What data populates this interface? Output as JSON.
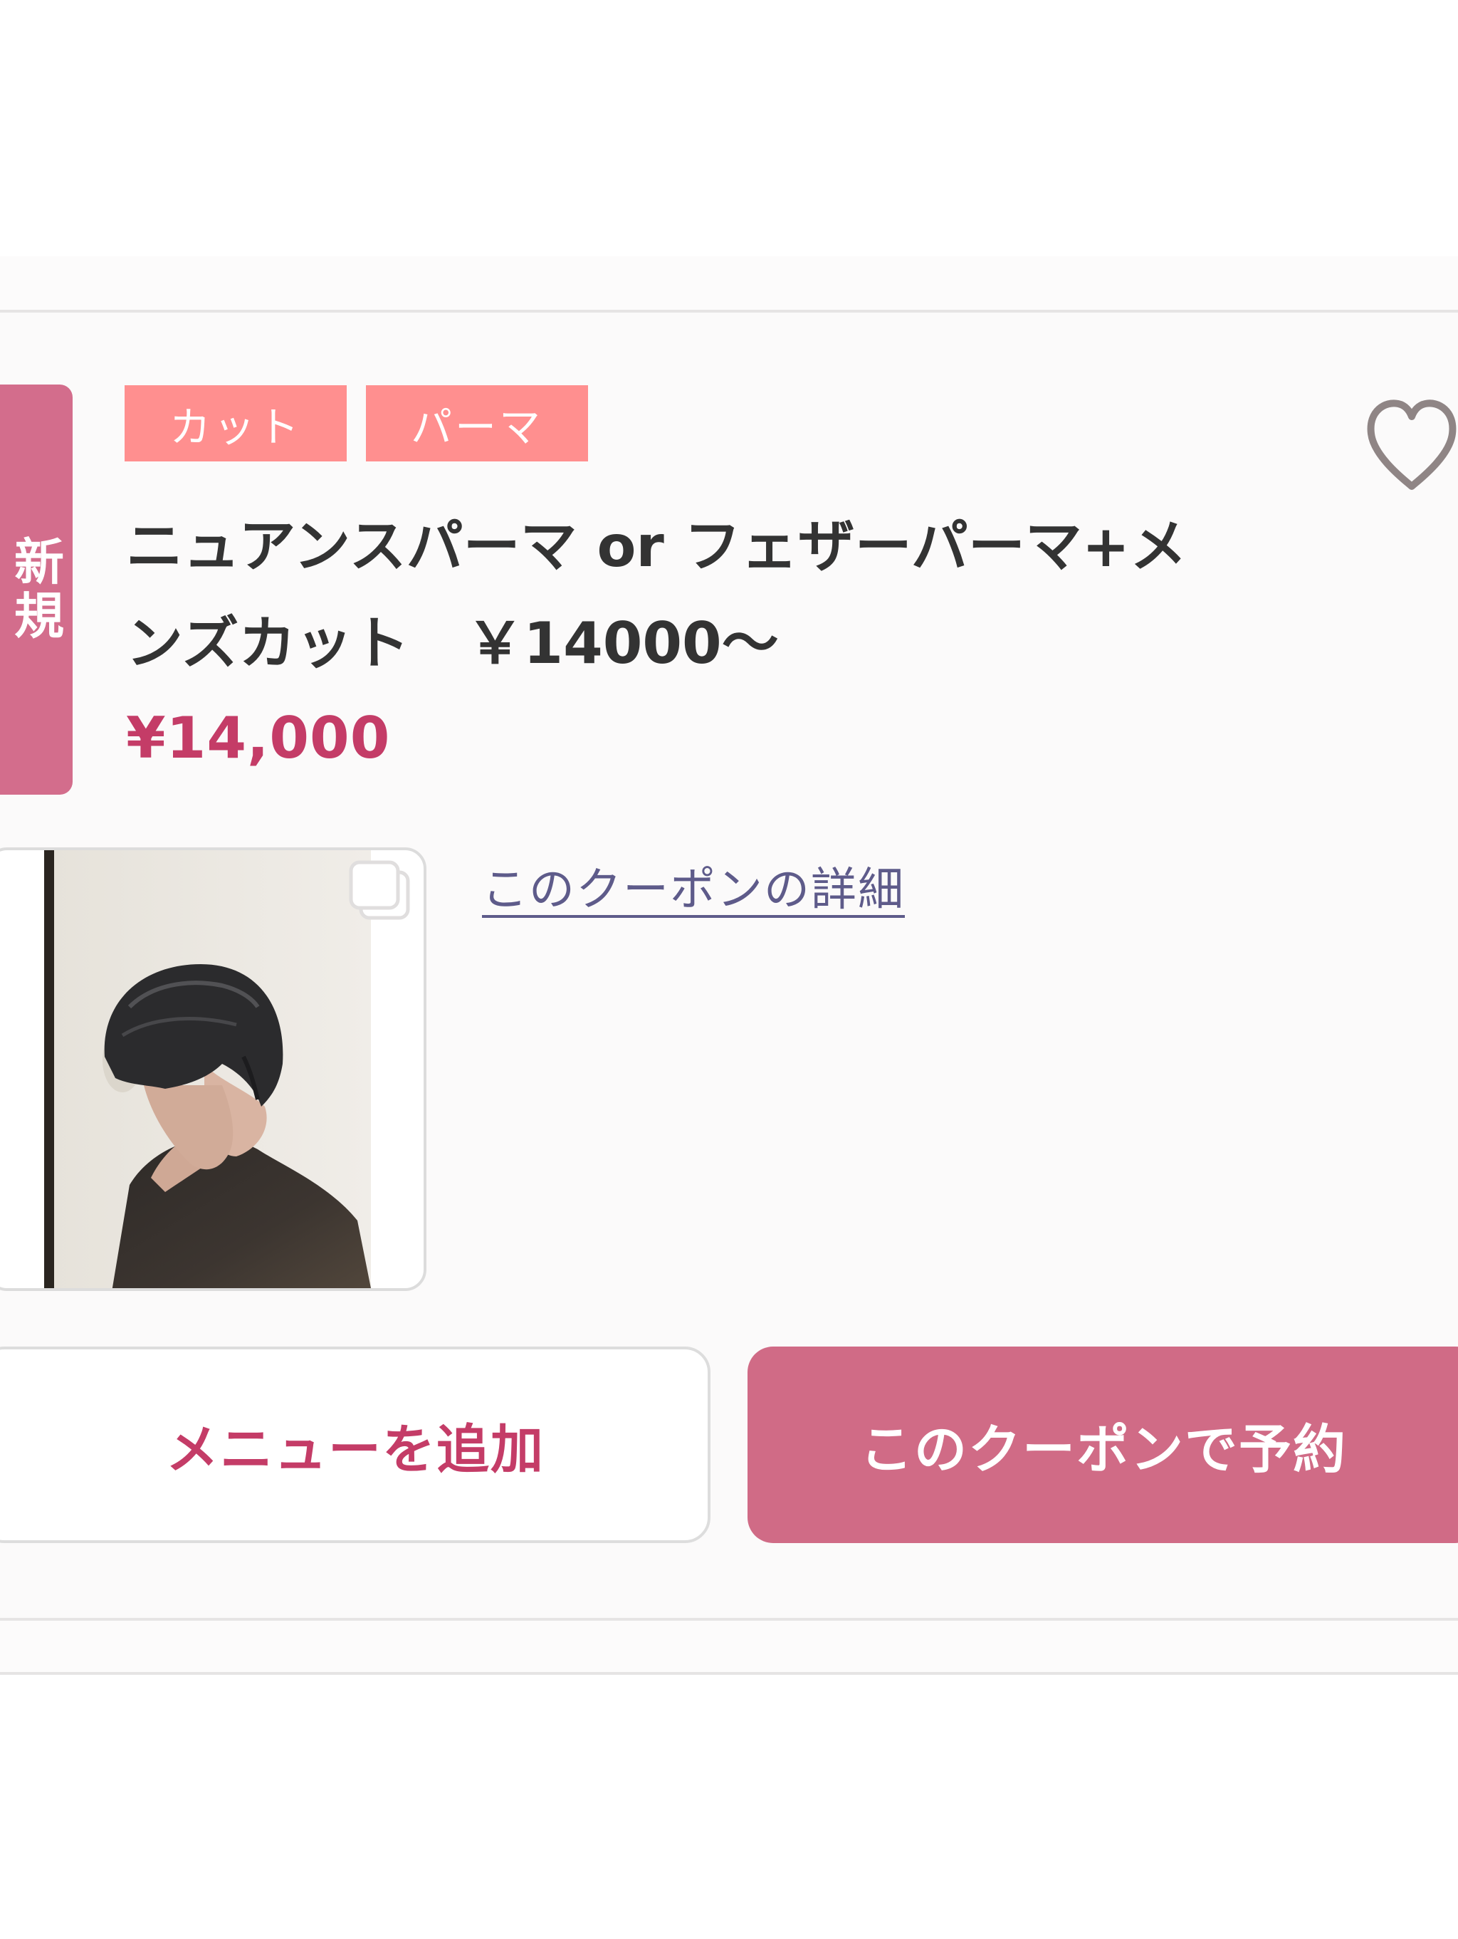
{
  "coupon": {
    "new_badge": "新規",
    "tags": [
      "カット",
      "パーマ"
    ],
    "title_line1": "ニュアンスパーマ or フェザーパーマ+メ",
    "title_line2": "ンズカット　￥14000〜",
    "price": "¥14,000",
    "detail_link": "このクーポンの詳細",
    "add_menu_button": "メニューを追加",
    "reserve_button": "このクーポンで予約"
  },
  "icons": {
    "favorite": "heart-outline-icon",
    "multi_photo": "multiple-images-icon"
  },
  "colors": {
    "accent": "#d06b86",
    "price": "#c43c67",
    "tag": "#ff8f8f",
    "link": "#5e5b8a"
  }
}
